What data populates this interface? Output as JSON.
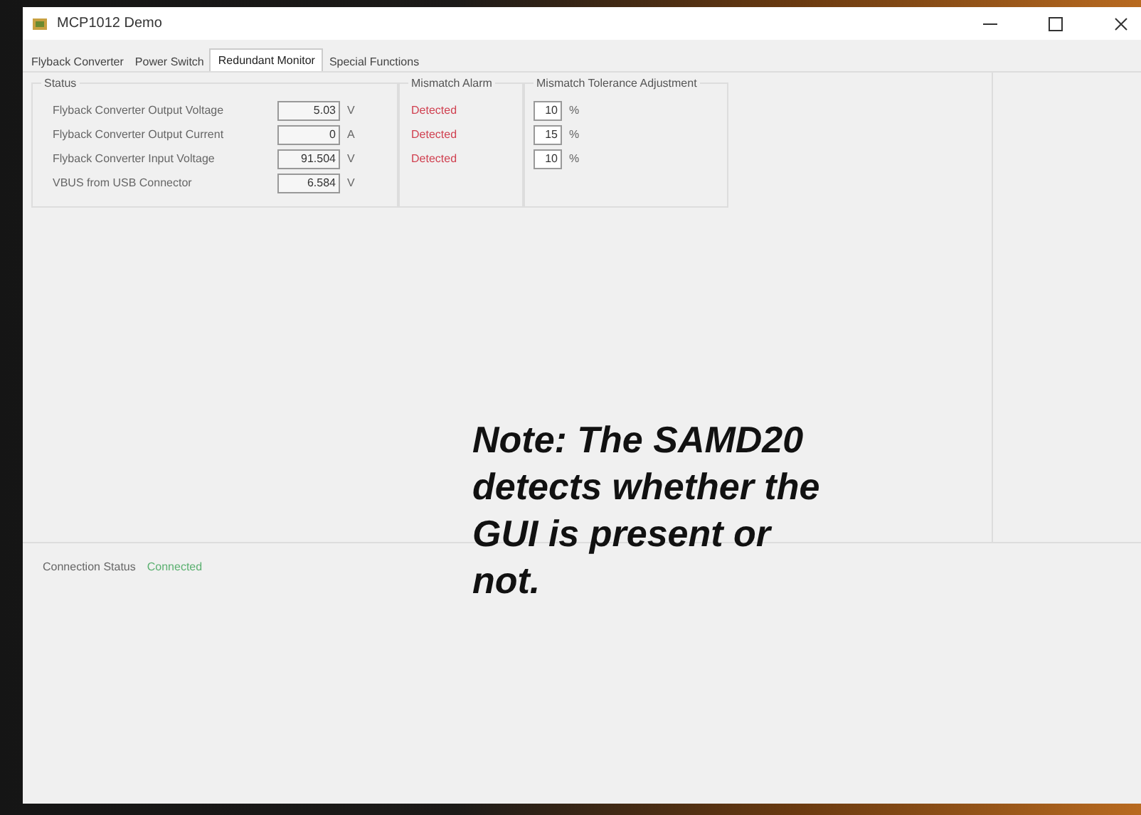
{
  "window": {
    "title": "MCP1012 Demo"
  },
  "tabs": [
    {
      "label": "Flyback Converter",
      "selected": false
    },
    {
      "label": "Power Switch",
      "selected": false
    },
    {
      "label": "Redundant Monitor",
      "selected": true
    },
    {
      "label": "Special Functions",
      "selected": false
    }
  ],
  "status_group": {
    "title": "Status",
    "rows": [
      {
        "label": "Flyback Converter Output Voltage",
        "value": "5.03",
        "unit": "V"
      },
      {
        "label": "Flyback Converter Output Current",
        "value": "0",
        "unit": "A"
      },
      {
        "label": "Flyback Converter Input Voltage",
        "value": "91.504",
        "unit": "V"
      },
      {
        "label": "VBUS from USB Connector",
        "value": "6.584",
        "unit": "V"
      }
    ]
  },
  "mismatch_alarm": {
    "title": "Mismatch Alarm",
    "items": [
      "Detected",
      "Detected",
      "Detected"
    ]
  },
  "tolerance": {
    "title": "Mismatch Tolerance Adjustment",
    "rows": [
      {
        "value": "10",
        "unit": "%"
      },
      {
        "value": "15",
        "unit": "%"
      },
      {
        "value": "10",
        "unit": "%"
      }
    ]
  },
  "connection": {
    "label": "Connection Status",
    "value": "Connected"
  },
  "note": "**Note:**  The SAMD20 detects whether the GUI is present or not."
}
